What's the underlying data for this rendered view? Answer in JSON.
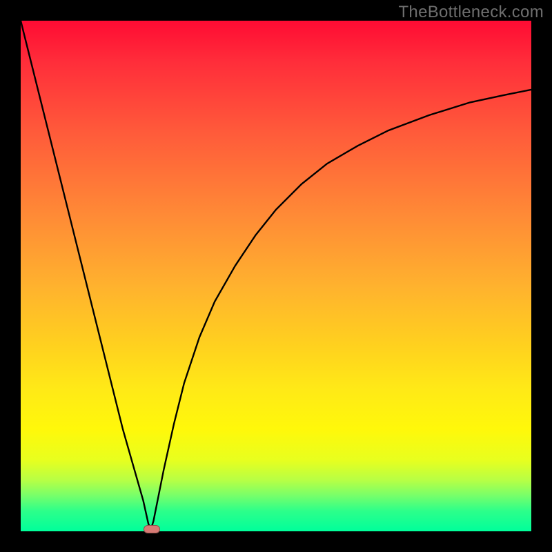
{
  "watermark": "TheBottleneck.com",
  "colors": {
    "black_frame": "#000000",
    "gradient_top": "#ff0b33",
    "gradient_mid_upper": "#ff8a36",
    "gradient_mid": "#ffd21e",
    "gradient_mid_lower": "#fff80a",
    "gradient_bottom": "#00ff9b",
    "curve": "#000000",
    "marker": "#d77a74"
  },
  "chart_data": {
    "type": "line",
    "title": "",
    "xlabel": "",
    "ylabel": "",
    "xlim": [
      0,
      100
    ],
    "ylim": [
      0,
      100
    ],
    "series": [
      {
        "name": "left-branch",
        "x": [
          0,
          2,
          4,
          6,
          8,
          10,
          12,
          14,
          16,
          18,
          20,
          22,
          24,
          25,
          25.5
        ],
        "values": [
          100,
          92,
          84,
          76,
          68,
          60,
          52,
          44,
          36,
          28,
          20,
          13,
          6,
          1.5,
          0.4
        ]
      },
      {
        "name": "right-branch",
        "x": [
          25.5,
          26,
          27,
          28,
          30,
          32,
          35,
          38,
          42,
          46,
          50,
          55,
          60,
          66,
          72,
          80,
          88,
          95,
          100
        ],
        "values": [
          0.4,
          2,
          7,
          12,
          21,
          29,
          38,
          45,
          52,
          58,
          63,
          68,
          72,
          75.5,
          78.5,
          81.5,
          84,
          85.5,
          86.5
        ]
      }
    ],
    "annotations": [
      {
        "name": "min-marker",
        "x": 25.5,
        "y": 0.5,
        "w": 3.0,
        "h": 1.4
      }
    ],
    "legend": [],
    "grid": false
  }
}
